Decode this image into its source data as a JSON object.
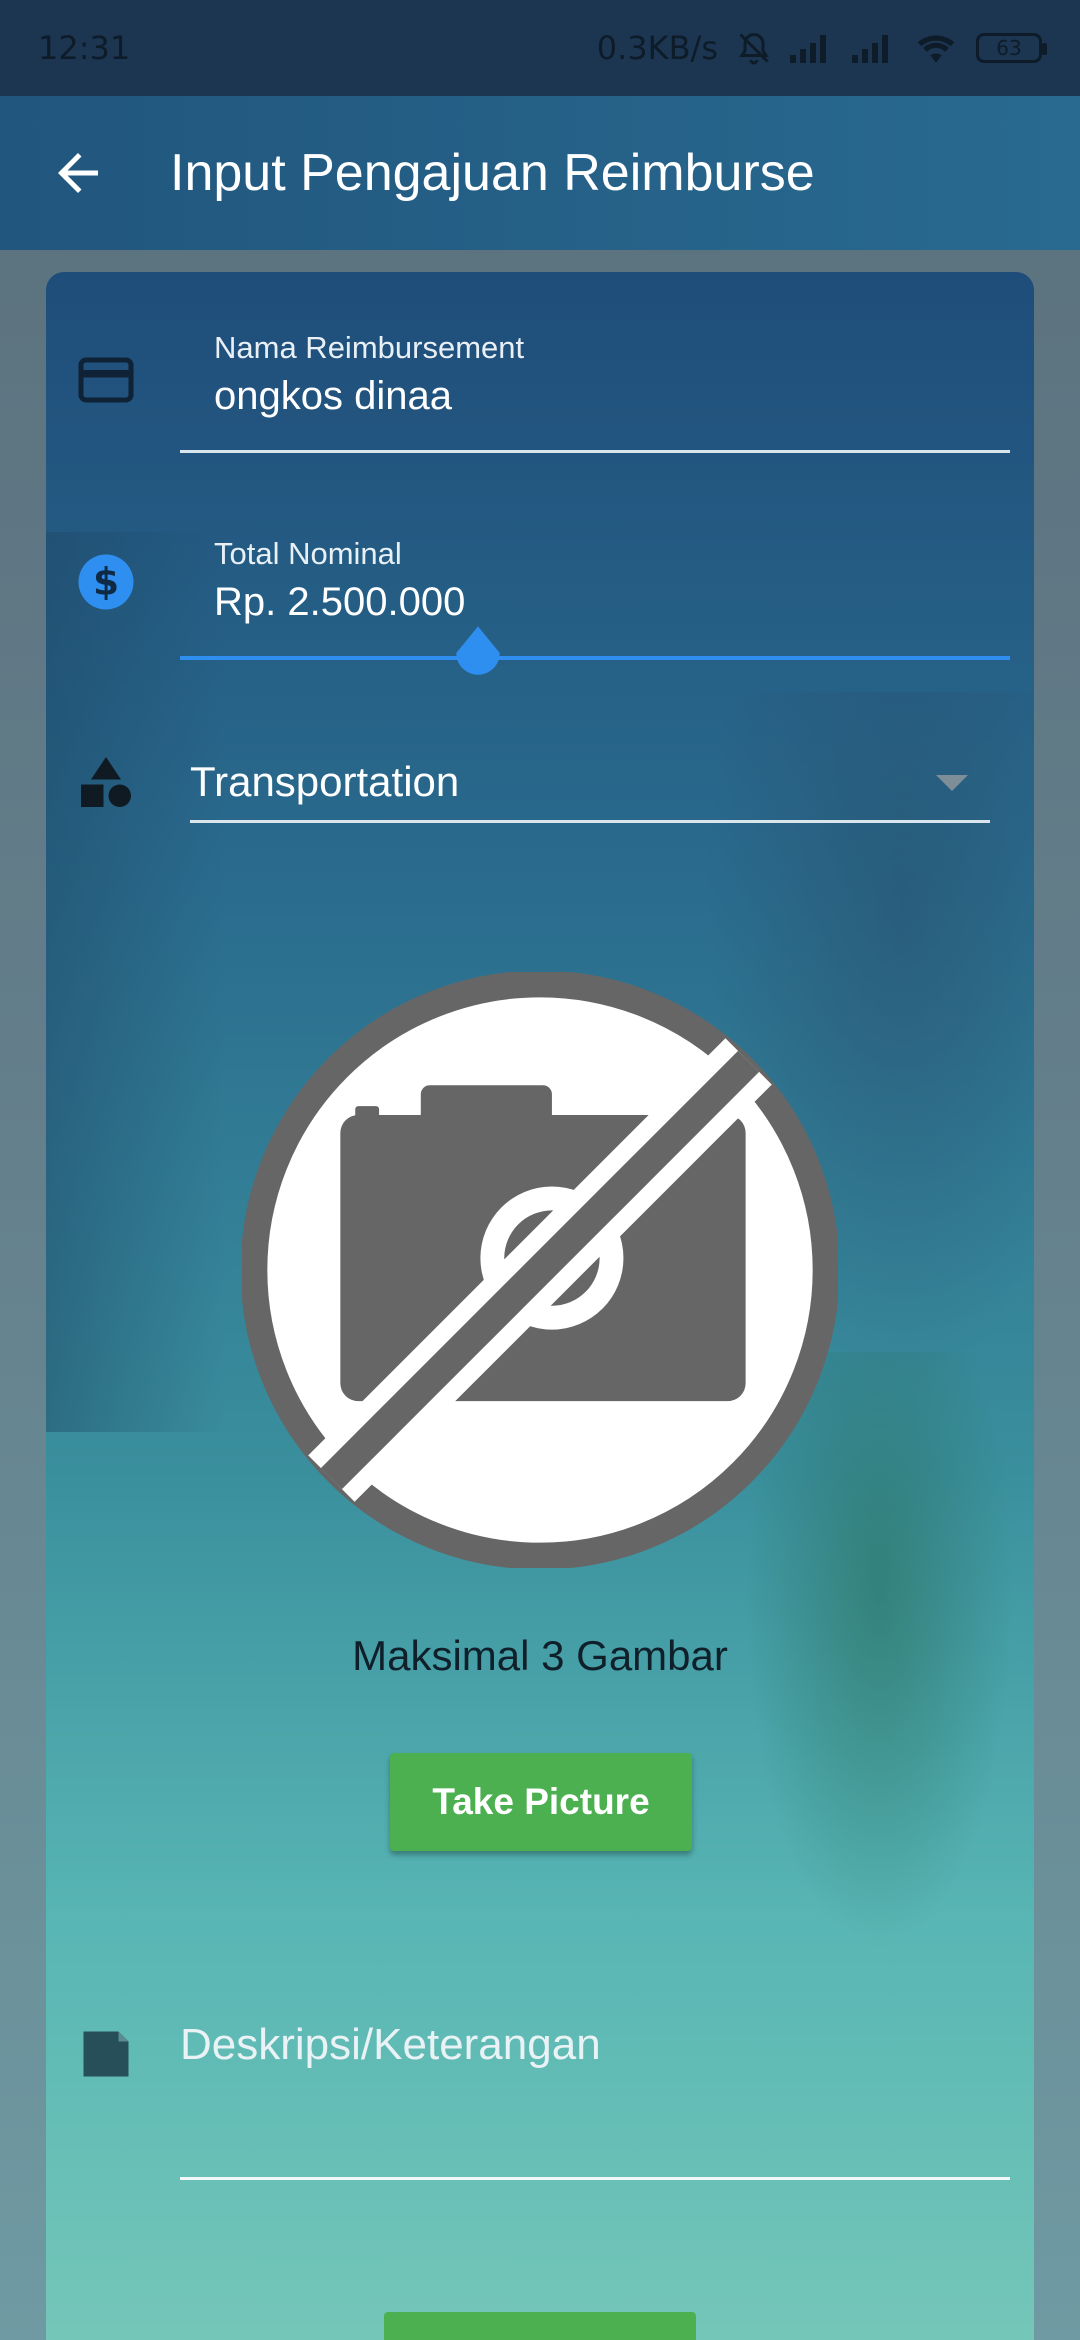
{
  "status_bar": {
    "time": "12:31",
    "speed": "0.3KB/s",
    "battery": "63"
  },
  "app_bar": {
    "title": "Input Pengajuan Reimburse",
    "back_icon": "arrow-left-icon"
  },
  "form": {
    "name_field": {
      "label": "Nama Reimbursement",
      "value": "ongkos dinaa",
      "icon": "card-icon"
    },
    "amount_field": {
      "label": "Total Nominal",
      "value": "Rp. 2.500.000",
      "icon": "dollar-circle-icon"
    },
    "category": {
      "selected": "Transportation",
      "icon": "shapes-icon"
    },
    "image_section": {
      "icon": "no-camera-icon",
      "note": "Maksimal 3 Gambar",
      "button_label": "Take Picture"
    },
    "description_field": {
      "placeholder": "Deskripsi/Keterangan",
      "icon": "note-icon"
    }
  },
  "colors": {
    "accent_blue": "#2f8ff0",
    "button_green": "#4caf50",
    "appbar": "#21567e"
  }
}
